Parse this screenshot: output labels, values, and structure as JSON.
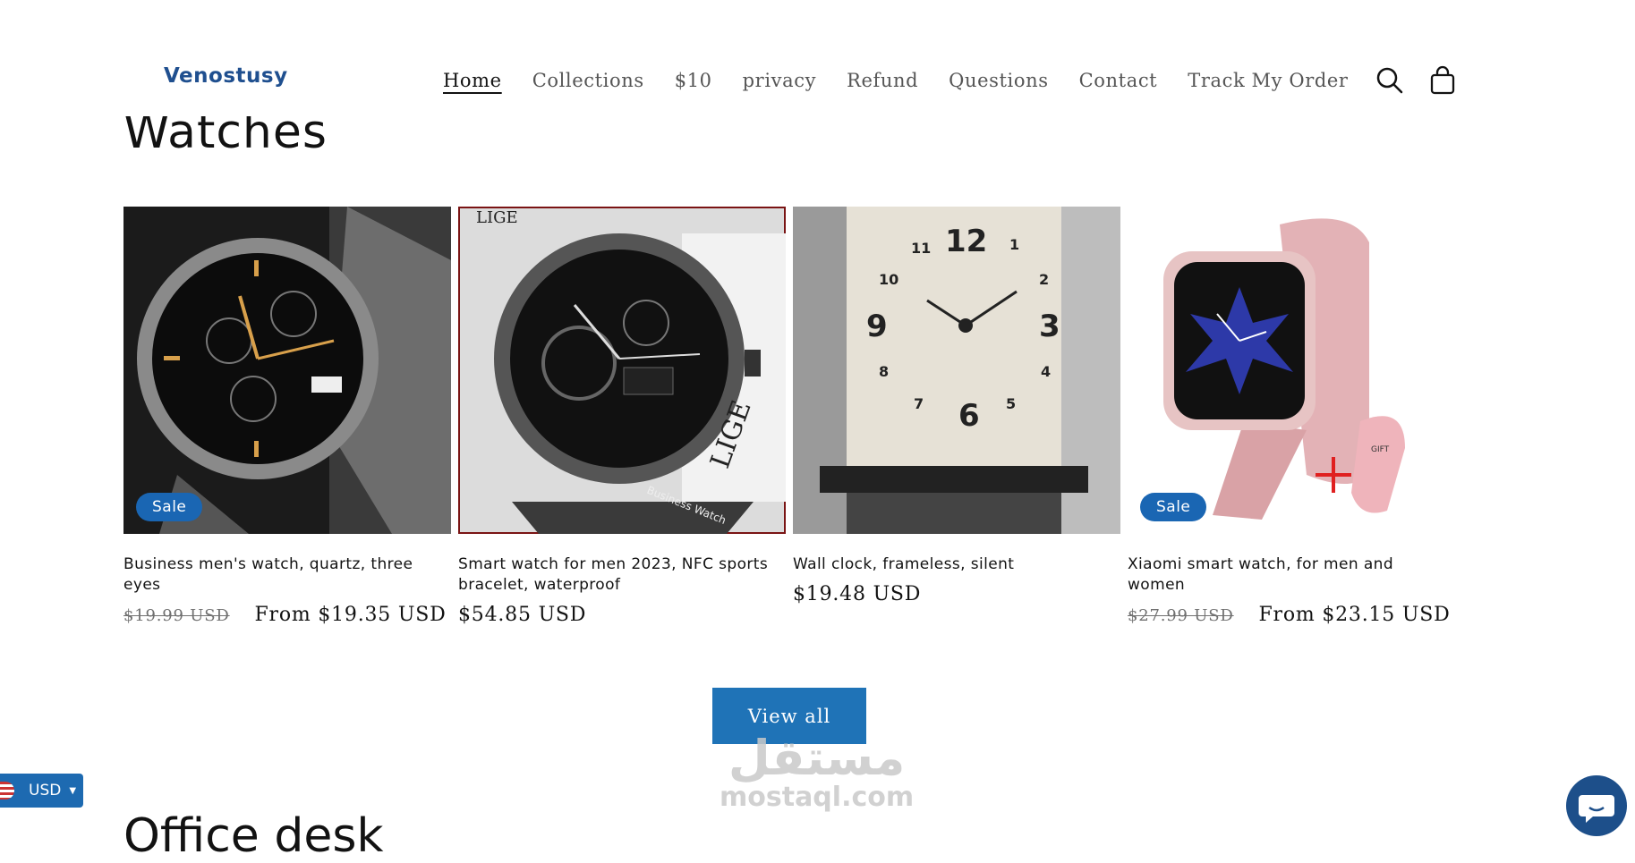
{
  "header": {
    "logo": "Venostusy",
    "nav": [
      "Home",
      "Collections",
      "$10",
      "privacy",
      "Refund",
      "Questions",
      "Contact",
      "Track My Order"
    ],
    "active_nav": "Home",
    "icons": [
      "search-icon",
      "cart-icon"
    ]
  },
  "section": {
    "title": "Watches",
    "products": [
      {
        "title": "Business men's watch, quartz, three eyes",
        "badge": "Sale",
        "old_price": "$19.99 USD",
        "price": "From $19.35 USD"
      },
      {
        "title": "Smart watch for men 2023, NFC sports bracelet, waterproof",
        "badge": "",
        "old_price": "",
        "price": "$54.85 USD",
        "image_text": {
          "brand": "LIGE",
          "strap_brand": "LIGE",
          "band": "Business Watch"
        }
      },
      {
        "title": "Wall clock, frameless, silent",
        "badge": "",
        "old_price": "",
        "price": "$19.48 USD"
      },
      {
        "title": "Xiaomi smart watch, for men and women",
        "badge": "Sale",
        "old_price": "$27.99 USD",
        "price": "From $23.15 USD",
        "image_text": {
          "gift": "GIFT"
        }
      }
    ],
    "view_all": "View all"
  },
  "next_section_title": "Office desk",
  "currency": {
    "label": "USD"
  },
  "watermark": {
    "arabic": "مستقل",
    "latin": "mostaql.com"
  },
  "colors": {
    "accent": "#1f73b7",
    "badge": "#1a66b3",
    "logo": "#1f4f8f"
  }
}
